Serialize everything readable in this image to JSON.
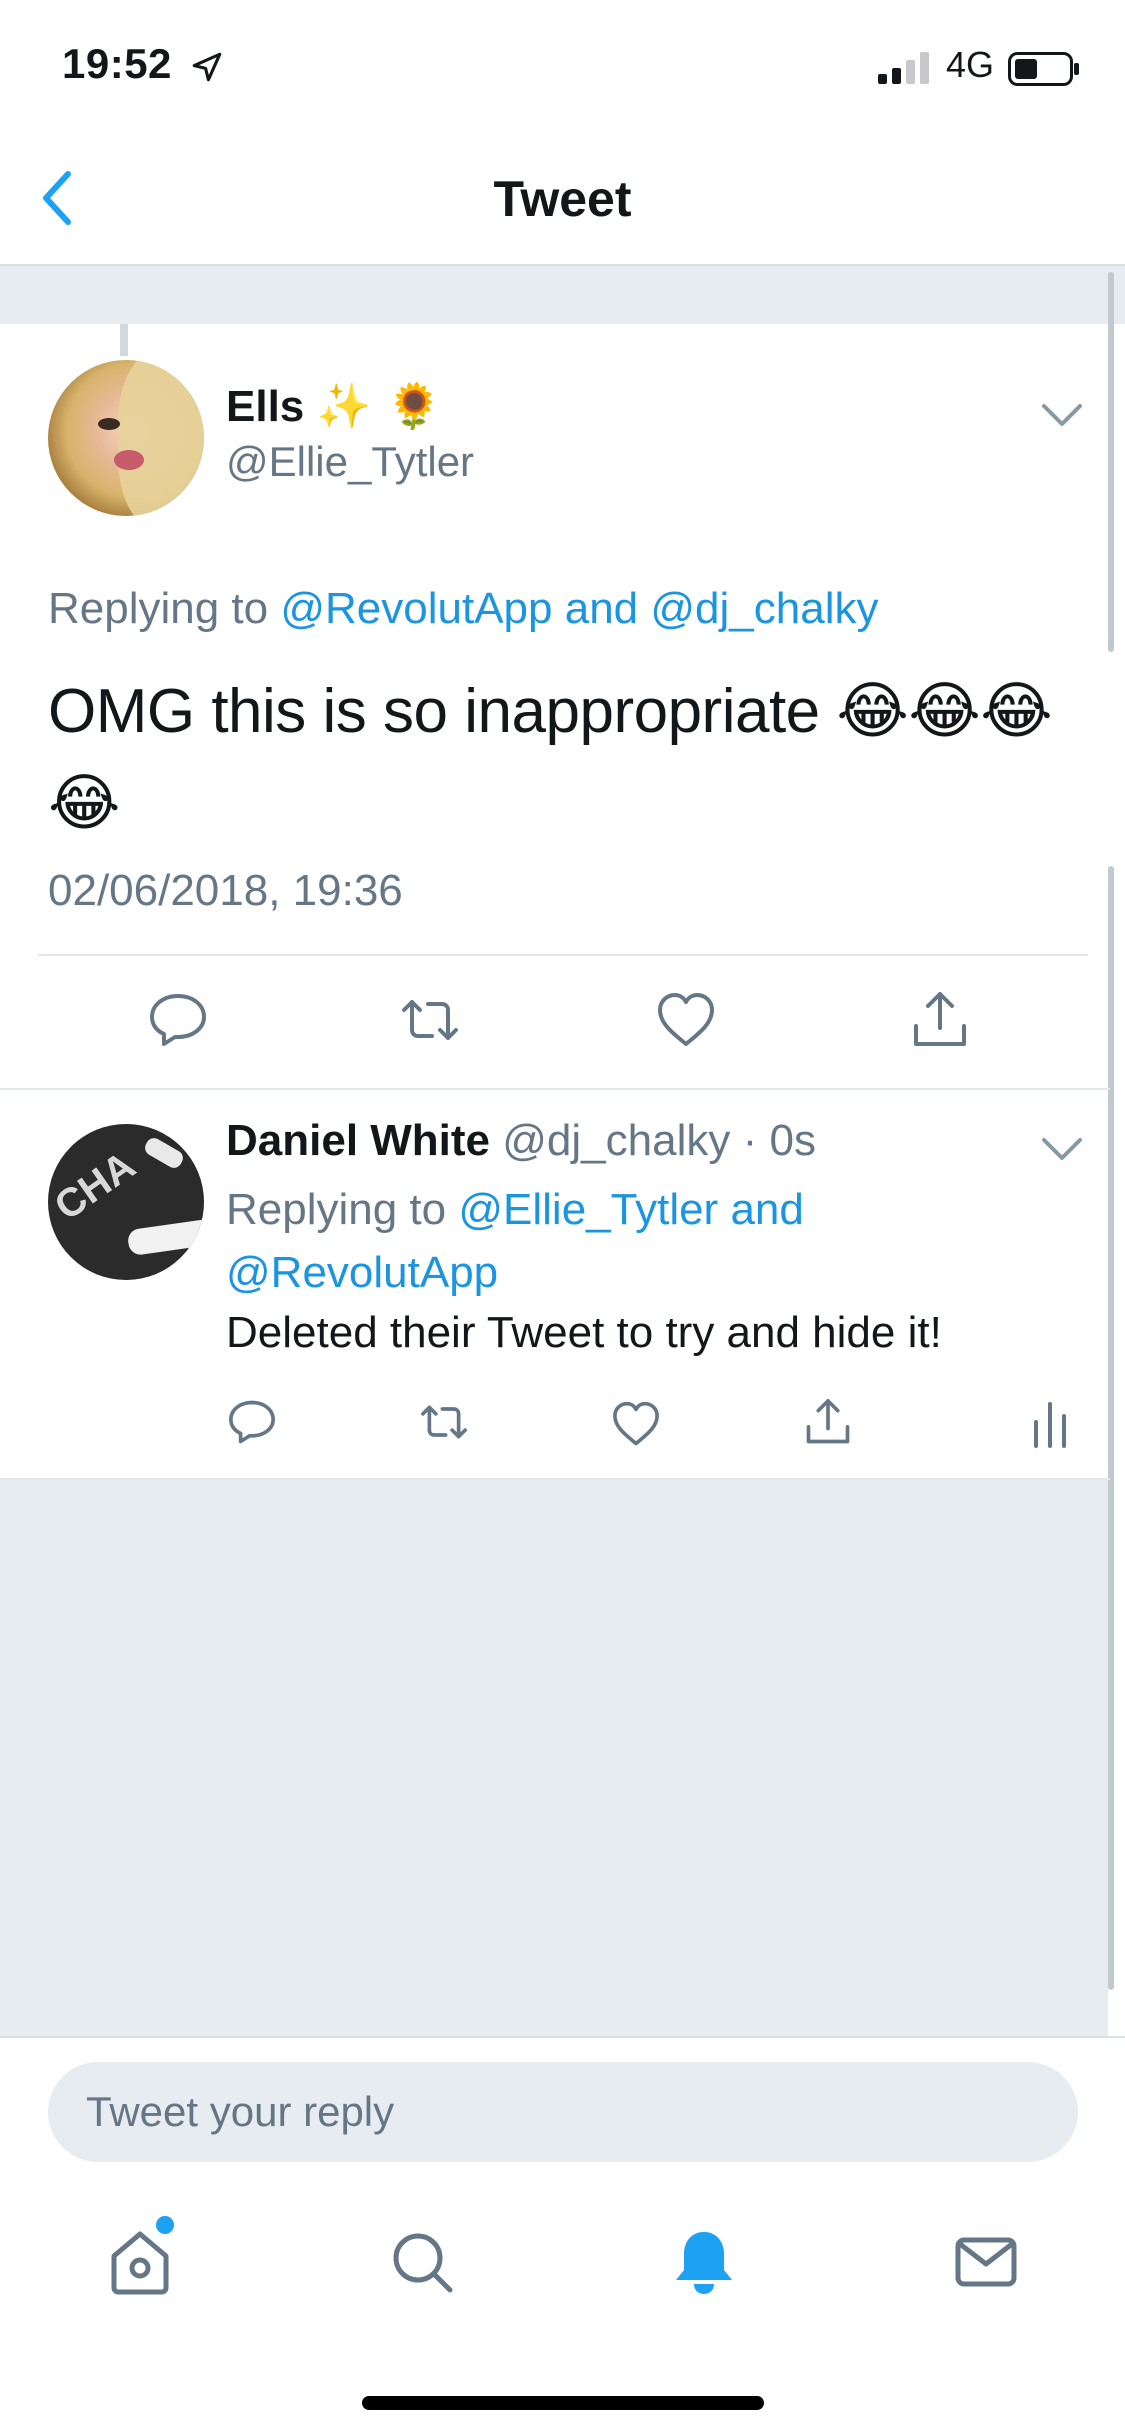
{
  "status_bar": {
    "time": "19:52",
    "network": "4G",
    "icons": [
      "location-arrow-icon",
      "signal-bars-icon",
      "battery-icon"
    ]
  },
  "nav": {
    "title": "Tweet",
    "back_icon": "chevron-left-icon"
  },
  "main_tweet": {
    "display_name": "Ells",
    "name_emoji": "✨ 🌻",
    "handle": "@Ellie_Tytler",
    "replying_prefix": "Replying to ",
    "replying_links": "@RevolutApp and @dj_chalky",
    "text": "OMG this is so inappropriate 😂😂😂 😂",
    "timestamp": "02/06/2018, 19:36",
    "actions": [
      "reply-icon",
      "retweet-icon",
      "like-icon",
      "share-icon"
    ]
  },
  "reply_tweet": {
    "display_name": "Daniel White",
    "handle_time": "@dj_chalky · 0s",
    "replying_prefix": "Replying to ",
    "replying_links": "@Ellie_Tytler and @RevolutApp",
    "text": "Deleted their Tweet to try and hide it!",
    "actions": [
      "reply-icon",
      "retweet-icon",
      "like-icon",
      "share-icon",
      "analytics-icon"
    ]
  },
  "composer": {
    "placeholder": "Tweet your reply",
    "value": ""
  },
  "tab_bar": {
    "items": [
      "home-icon",
      "search-icon",
      "notifications-icon",
      "messages-icon"
    ],
    "active": "notifications-icon"
  },
  "colors": {
    "link": "#1b95e0",
    "secondary_text": "#657786",
    "background_gray": "#e6ecf0",
    "active_tab": "#1da1f2"
  }
}
